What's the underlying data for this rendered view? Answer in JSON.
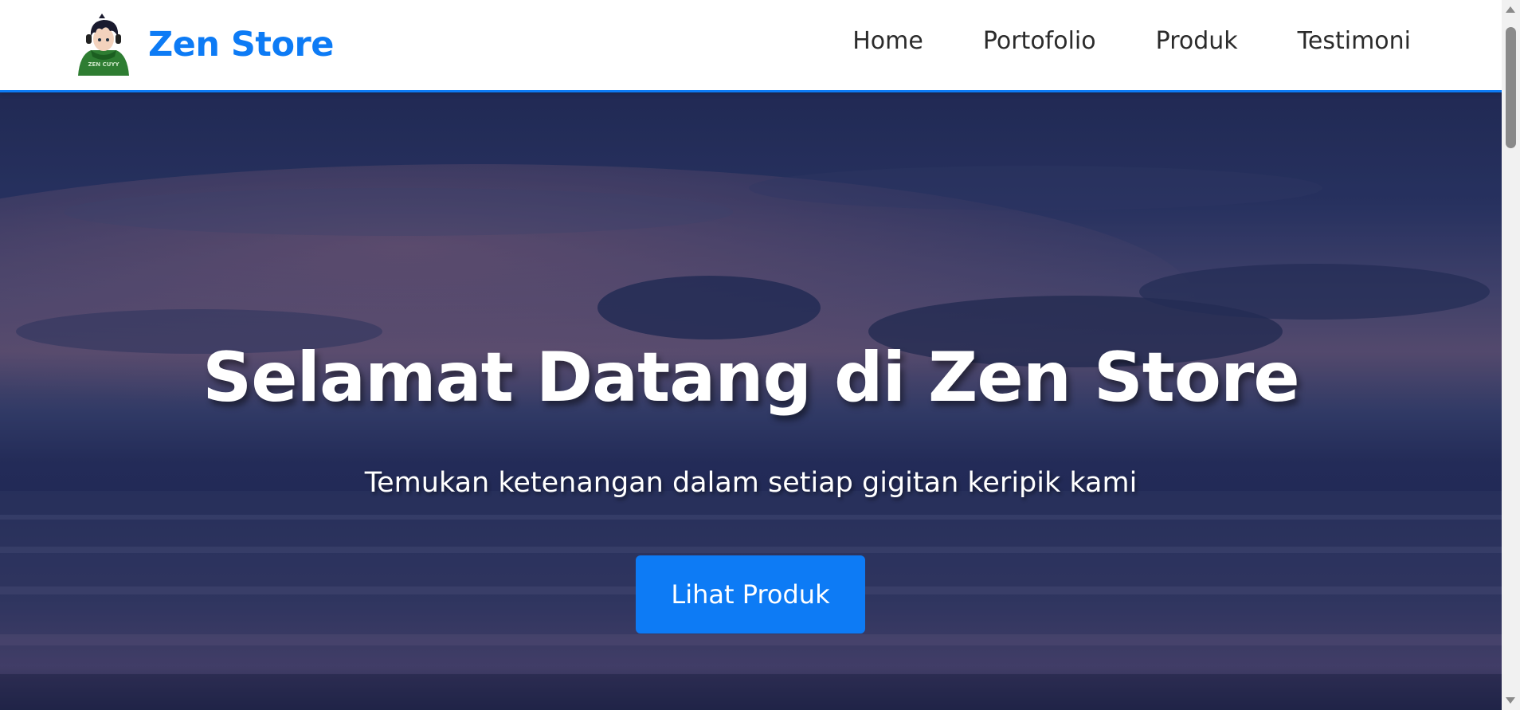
{
  "header": {
    "brand_name": "Zen Store",
    "logo_icon": "anime-avatar-logo",
    "logo_text": "ZEN CUYY",
    "nav": [
      {
        "label": "Home"
      },
      {
        "label": "Portofolio"
      },
      {
        "label": "Produk"
      },
      {
        "label": "Testimoni"
      }
    ]
  },
  "hero": {
    "title": "Selamat Datang di Zen Store",
    "subtitle": "Temukan ketenangan dalam setiap gigitan keripik kami",
    "cta_label": "Lihat Produk",
    "background": "sunset-sea-photo"
  },
  "colors": {
    "accent": "#0d7bf5",
    "nav_text": "#2b2b2b",
    "hero_text": "#ffffff"
  }
}
